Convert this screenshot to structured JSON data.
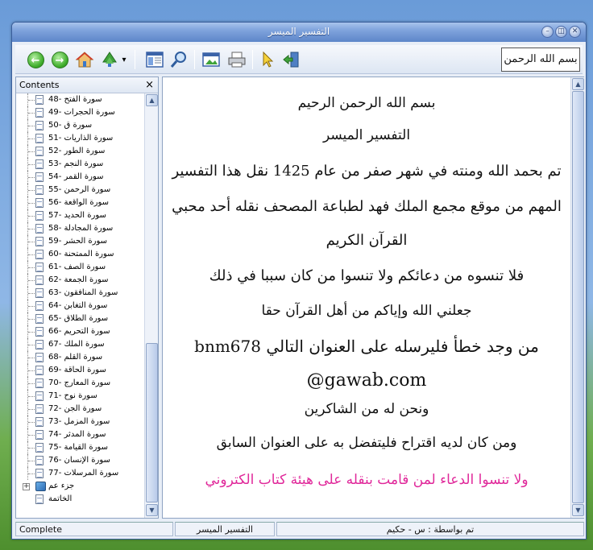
{
  "window": {
    "title": "التفسير الميسر"
  },
  "title_buttons": [
    "minimize-button",
    "restore-button",
    "close-button"
  ],
  "toolbar": {
    "back_glyph": "←",
    "forward_glyph": "→",
    "dropdown_glyph": "▾",
    "logo_text": "بسم الله الرحمن الرحيم"
  },
  "contents_panel": {
    "title": "Contents",
    "close_glyph": "×",
    "items": [
      "سورة الفتح -48",
      "سورة الحجرات -49",
      "سورة ق -50",
      "سورة الذاريات -51",
      "سورة الطور -52",
      "سورة النجم -53",
      "سورة القمر -54",
      "سورة الرحمن -55",
      "سورة الواقعة -56",
      "سورة الحديد -57",
      "سورة المجادلة -58",
      "سورة الحشر -59",
      "سورة الممتحنة -60",
      "سورة الصف -61",
      "سورة الجمعة -62",
      "سورة المنافقون -63",
      "سورة التغابن -64",
      "سورة الطلاق -65",
      "سورة التحريم -66",
      "سورة الملك -67",
      "سورة القلم -68",
      "سورة الحاقة -69",
      "سورة المعارج -70",
      "سورة نوح -71",
      "سورة الجن -72",
      "سورة المزمل -73",
      "سورة المدثر -74",
      "سورة القيامة -75",
      "سورة الإنسان -76",
      "سورة المرسلات -77"
    ],
    "folder_label": "جزء عم",
    "final_label": "الخاتمة"
  },
  "content": {
    "lines": [
      "بسم الله الرحمن الرحيم",
      "التفسير الميسر",
      "تم بحمد الله ومنته في شهر صفر من عام 1425 نقل هذا التفسير",
      "المهم من موقع مجمع الملك فهد لطباعة المصحف نقله أحد محبي",
      "القرآن الكريم",
      "فلا تنسوه من دعائكم ولا تنسوا من كان سببا في ذلك",
      "جعلني الله وإياكم من أهل القرآن حقا",
      "من وجد خطأ فليرسله على العنوان التالي bnm678",
      "@gawab.com",
      "ونحن له من الشاكرين",
      "ومن كان لديه اقتراح فليتفضل به على العنوان السابق",
      "ولا تنسوا الدعاء لمن قامت بنقله على هيئة كتاب الكتروني"
    ],
    "highlight_color": "#e0289a",
    "text_color": "#111111"
  },
  "statusbar": {
    "left": "Complete",
    "middle": "التفسير الميسر",
    "right": "تم بواسطة : س - حكيم"
  }
}
